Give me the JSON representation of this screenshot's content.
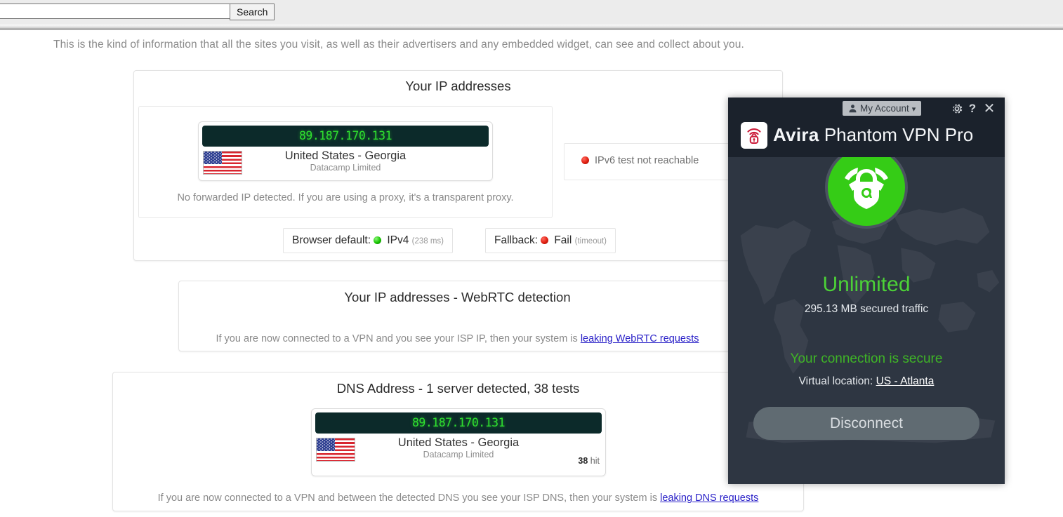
{
  "search": {
    "value": "",
    "placeholder": "",
    "button_label": "Search"
  },
  "intro": "This is the kind of information that all the sites you visit, as well as their advertisers and any embedded widget, can see and collect about you.",
  "ip_panel": {
    "title": "Your IP addresses",
    "card": {
      "ip": "89.187.170.131",
      "country_region": "United States - Georgia",
      "isp": "Datacamp Limited"
    },
    "forwarded_note": "No forwarded IP detected. If you are using a proxy, it's a transparent proxy.",
    "ipv6_status": "IPv6 test not reachable",
    "ipv6_dot_color": "#e01f10",
    "browser_default": {
      "label": "Browser default:",
      "value": "IPv4",
      "detail": "(238 ms)",
      "dot_color": "#17c400"
    },
    "fallback": {
      "label": "Fallback:",
      "value": "Fail",
      "detail": "(timeout)",
      "dot_color": "#e01f10"
    }
  },
  "webrtc_panel": {
    "title": "Your IP addresses - WebRTC detection",
    "note_prefix": "If you are now connected to a VPN and you see your ISP IP, then your system is ",
    "note_link": "leaking WebRTC requests"
  },
  "dns_panel": {
    "title": "DNS Address - 1 server detected, 38 tests",
    "card": {
      "ip": "89.187.170.131",
      "country_region": "United States - Georgia",
      "isp": "Datacamp Limited",
      "hit_count": "38",
      "hit_label": "hit"
    },
    "note_prefix": "If you are now connected to a VPN and between the detected DNS you see your ISP DNS, then your system is ",
    "note_link": "leaking DNS requests"
  },
  "vpn": {
    "account_button": "My Account",
    "brand_primary": "Avira",
    "brand_secondary": "Phantom VPN Pro",
    "status_title": "Unlimited",
    "traffic": "295.13 MB secured traffic",
    "connection_status": "Your connection is secure",
    "virtual_location_label": "Virtual location:",
    "virtual_location_value": "US - Atlanta",
    "disconnect_label": "Disconnect",
    "colors": {
      "shield_green": "#35cc16",
      "status_green": "#4cd137",
      "secure_green": "#3fb526",
      "panel_bg": "#2e3642",
      "header_bg": "#1b222c",
      "brand_red": "#cc1e3c"
    }
  }
}
